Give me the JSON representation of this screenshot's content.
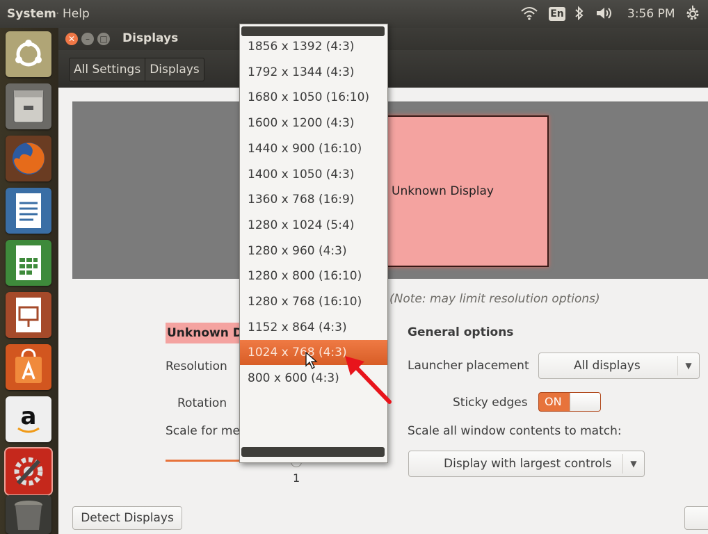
{
  "top_panel": {
    "menu_system": "System",
    "menu_help": "Help",
    "keyboard_layout": "En",
    "clock": "3:56 PM"
  },
  "launcher": {
    "items": [
      "ubuntu-dash-icon",
      "files-icon",
      "firefox-icon",
      "writer-icon",
      "calc-icon",
      "impress-icon",
      "software-center-icon",
      "amazon-icon",
      "system-settings-icon",
      "trash-icon"
    ]
  },
  "window": {
    "title": "Displays",
    "breadcrumbs": [
      "All Settings",
      "Displays"
    ]
  },
  "preview": {
    "display_label": "Unknown Display"
  },
  "note": "(Note: may limit resolution options)",
  "monitor": {
    "name": "Unknown Di",
    "resolution_label": "Resolution",
    "rotation_label": "Rotation",
    "scale_label": "Scale for me",
    "scale_value": "1"
  },
  "general": {
    "heading": "General options",
    "launcher_placement_label": "Launcher placement",
    "launcher_placement_value": "All displays",
    "sticky_edges_label": "Sticky edges",
    "sticky_edges_state": "ON",
    "scale_all_label": "Scale all window contents to match:",
    "scale_all_value": "Display with largest controls"
  },
  "detect_button": "Detect Displays",
  "resolution_dropdown": {
    "options": [
      "1856 x 1392 (4:3)",
      "1792 x 1344 (4:3)",
      "1680 x 1050 (16:10)",
      "1600 x 1200 (4:3)",
      "1440 x 900 (16:10)",
      "1400 x 1050 (4:3)",
      "1360 x 768 (16:9)",
      "1280 x 1024 (5:4)",
      "1280 x 960 (4:3)",
      "1280 x 800 (16:10)",
      "1280 x 768 (16:10)",
      "1152 x 864 (4:3)",
      "1024 x 768 (4:3)",
      "800 x 600 (4:3)"
    ],
    "selected": "1024 x 768 (4:3)"
  },
  "colors": {
    "accent": "#e7733b",
    "display_fill": "#f4a3a0",
    "arrow": "#e8141b"
  }
}
